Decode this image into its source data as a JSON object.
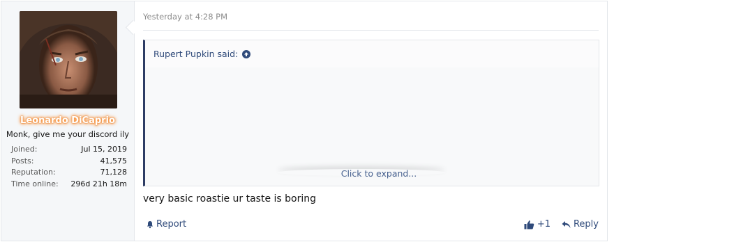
{
  "user": {
    "name": "Leonardo DiCaprio",
    "title": "Monk, give me your discord ily",
    "stats": [
      {
        "label": "Joined:",
        "value": "Jul 15, 2019"
      },
      {
        "label": "Posts:",
        "value": "41,575"
      },
      {
        "label": "Reputation:",
        "value": "71,128"
      },
      {
        "label": "Time online:",
        "value": "296d 21h 18m"
      }
    ]
  },
  "post": {
    "timestamp": "Yesterday at 4:28 PM",
    "quote": {
      "author": "Rupert Pupkin said:",
      "expand_label": "Click to expand..."
    },
    "message": "very basic roastie ur taste is boring",
    "actions": {
      "report": "Report",
      "like_count": "+1",
      "reply": "Reply"
    }
  },
  "icons": {
    "report": "bell-icon",
    "like": "thumbs-up-icon",
    "reply": "reply-icon",
    "quote_jump": "arrow-up-circle-icon"
  }
}
